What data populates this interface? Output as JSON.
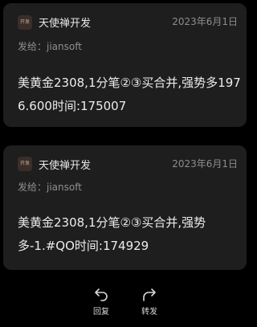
{
  "messages": [
    {
      "avatar_text": "开发",
      "sender": "天使禅开发",
      "date": "2023年6月1日",
      "to_label": "发给：",
      "to": "jiansoft",
      "body": "美黄金2308,1分笔②③买合并,强势多1976.600时间:175007"
    },
    {
      "avatar_text": "开发",
      "sender": "天使禅开发",
      "date": "2023年6月1日",
      "to_label": "发给：",
      "to": "jiansoft",
      "body": "美黄金2308,1分笔②③买合并,强势多-1.#QO时间:174929"
    }
  ],
  "actions": {
    "reply": {
      "label": "回复",
      "icon": "reply-icon"
    },
    "forward": {
      "label": "转发",
      "icon": "forward-icon"
    }
  },
  "colors": {
    "background": "#000000",
    "card": "#1e1e1e",
    "muted_text": "#8d8d8d"
  }
}
